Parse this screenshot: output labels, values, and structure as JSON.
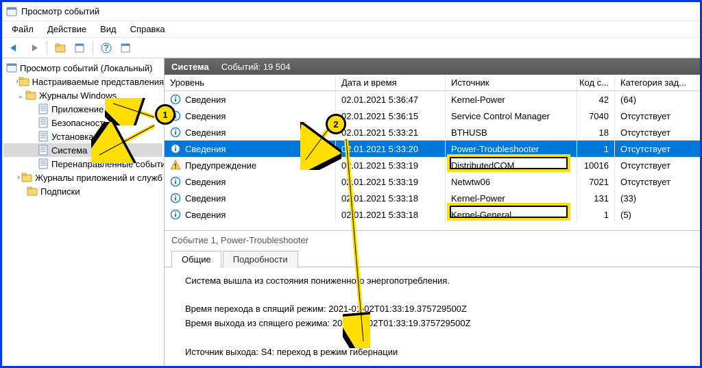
{
  "window_title": "Просмотр событий",
  "menu": {
    "file": "Файл",
    "action": "Действие",
    "view": "Вид",
    "help": "Справка"
  },
  "tree": {
    "root": "Просмотр событий (Локальный)",
    "custom": "Настраиваемые представления",
    "winlogs": "Журналы Windows",
    "app": "Приложение",
    "security": "Безопасность",
    "setup": "Установка",
    "system": "Система",
    "forwarded": "Перенаправленные события",
    "appserv": "Журналы приложений и служб",
    "subs": "Подписки"
  },
  "header": {
    "title": "Система",
    "count_label": "Событий: 19 504"
  },
  "columns": {
    "level": "Уровень",
    "date": "Дата и время",
    "source": "Источник",
    "code": "Код с...",
    "category": "Категория зад..."
  },
  "levels": {
    "info": "Сведения",
    "warn": "Предупреждение"
  },
  "rows": [
    {
      "lvl": "info",
      "date": "02.01.2021 5:36:47",
      "src": "Kernel-Power",
      "code": "42",
      "cat": "(64)"
    },
    {
      "lvl": "info",
      "date": "02.01.2021 5:36:15",
      "src": "Service Control Manager",
      "code": "7040",
      "cat": "Отсутствует"
    },
    {
      "lvl": "info",
      "date": "02.01.2021 5:33:21",
      "src": "BTHUSB",
      "code": "18",
      "cat": "Отсутствует"
    },
    {
      "lvl": "info",
      "date": "02.01.2021 5:33:20",
      "src": "Power-Troubleshooter",
      "code": "1",
      "cat": "Отсутствует",
      "sel": true
    },
    {
      "lvl": "warn",
      "date": "02.01.2021 5:33:19",
      "src": "DistributedCOM",
      "code": "10016",
      "cat": "Отсутствует"
    },
    {
      "lvl": "info",
      "date": "02.01.2021 5:33:19",
      "src": "Netwtw06",
      "code": "7021",
      "cat": "Отсутствует"
    },
    {
      "lvl": "info",
      "date": "02.01.2021 5:33:18",
      "src": "Kernel-Power",
      "code": "131",
      "cat": "(33)"
    },
    {
      "lvl": "info",
      "date": "02.01.2021 5:33:18",
      "src": "Kernel-General",
      "code": "1",
      "cat": "(5)"
    }
  ],
  "detail": {
    "title": "Событие 1, Power-Troubleshooter",
    "tab_general": "Общие",
    "tab_details": "Подробности",
    "line1": "Система вышла из состояния пониженного энергопотребления.",
    "line2": "Время перехода в спящий режим: 2021-01-02T01:33:19.375729500Z",
    "line3": "Время выхода из спящего режима: 2021-01-02T01:33:19.375729500Z",
    "line4": "Источник выхода: S4: переход в режим гибернации"
  },
  "callouts": {
    "one": "1",
    "two": "2"
  }
}
